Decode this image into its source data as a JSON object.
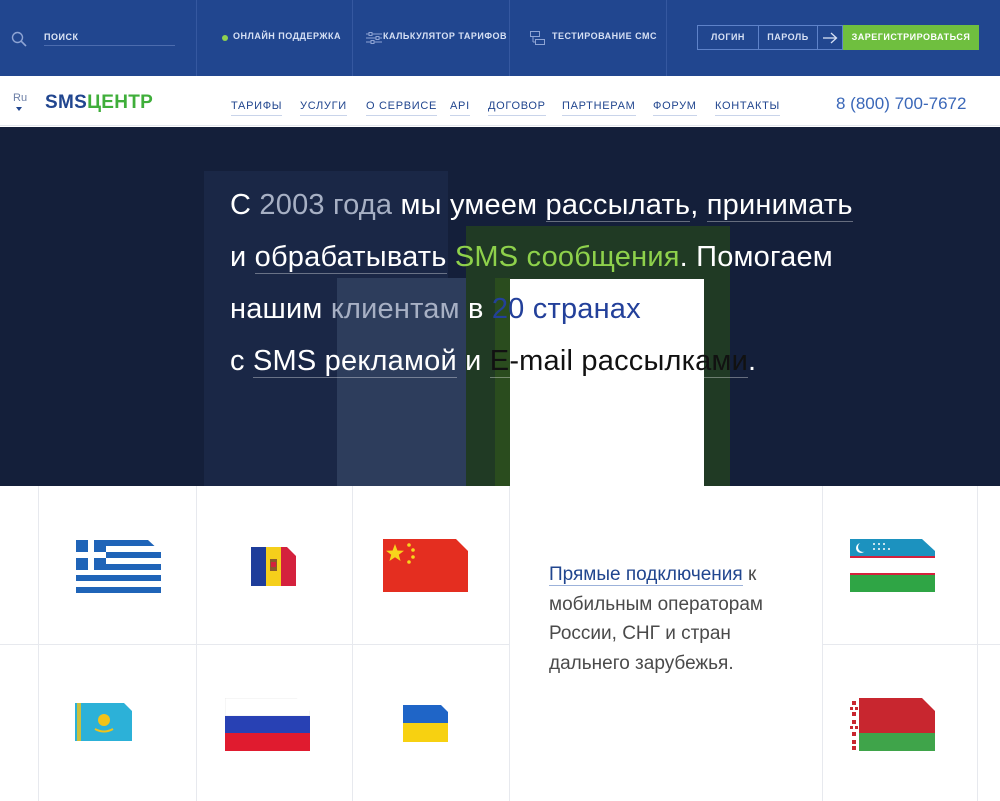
{
  "topbar": {
    "search_placeholder": "ПОИСК",
    "online_support": "ОНЛАЙН ПОДДЕРЖКА",
    "tariff_calculator": "КАЛЬКУЛЯТОР ТАРИФОВ",
    "sms_testing": "ТЕСТИРОВАНИЕ СМС",
    "login": "ЛОГИН",
    "password": "ПАРОЛЬ",
    "register": "ЗАРЕГИСТРИРОВАТЬСЯ"
  },
  "navbar": {
    "language": "Ru",
    "logo_sms": "SMS",
    "logo_centr": "ЦЕНТР",
    "items": [
      "ТАРИФЫ",
      "УСЛУГИ",
      "О СЕРВИСЕ",
      "API",
      "ДОГОВОР",
      "ПАРТНЕРАМ",
      "ФОРУМ",
      "КОНТАКТЫ"
    ],
    "phone": "8 (800) 700-7672"
  },
  "hero": {
    "l1_a": "С ",
    "l1_b": "2003 года",
    "l1_c": " мы умеем ",
    "l1_d": "рассылать",
    "l1_e": ", ",
    "l1_f": "принимать",
    "l2_a": "и ",
    "l2_b": "обрабатывать",
    "l2_c": " ",
    "l2_d": "SMS сообщения",
    "l2_e": ". Помогаем",
    "l3_a": "нашим ",
    "l3_b": "клиентам",
    "l3_c": " в ",
    "l3_d": "20 странах",
    "l4_a": "с ",
    "l4_b": "SMS рекламой",
    "l4_c": " и ",
    "l4_d": "E-mail",
    "l4_e": " ",
    "l4_f": "рассылками",
    "l4_g": "."
  },
  "promo": {
    "link": "Прямые подключения",
    "text": "к мобильным операторам России, СНГ и стран дальнего зарубежья."
  },
  "flags": [
    "greece-flag",
    "moldova-flag",
    "china-flag",
    "uzbekistan-flag",
    "kazakhstan-flag",
    "russia-flag",
    "ukraine-flag",
    "belarus-flag"
  ],
  "colors": {
    "topbar_bg": "#21468f",
    "accent_green": "#6fbf3f",
    "hero_bg": "#141f3a",
    "link_blue": "#21468f"
  }
}
